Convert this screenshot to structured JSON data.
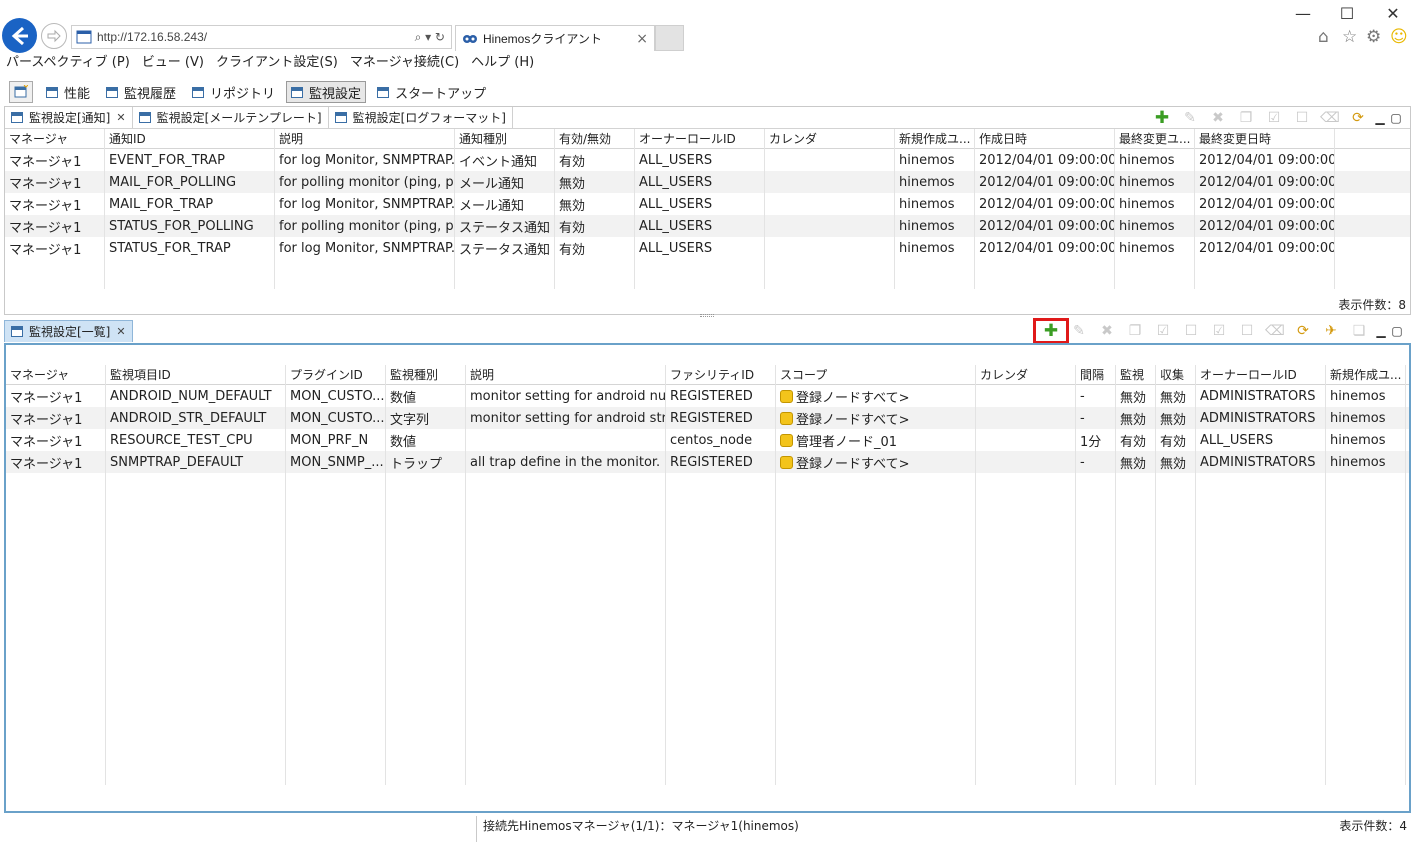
{
  "browser": {
    "url": "http://172.16.58.243/",
    "tab_title": "Hinemosクライアント",
    "url_controls": "⌕ ▾ ↻"
  },
  "menu": [
    "パースペクティブ (P)",
    "ビュー (V)",
    "クライアント設定(S)",
    "マネージャ接続(C)",
    "ヘルプ (H)"
  ],
  "perspectives": [
    "性能",
    "監視履歴",
    "リポジトリ",
    "監視設定",
    "スタートアップ"
  ],
  "upper": {
    "tabs": [
      "監視設定[通知]",
      "監視設定[メールテンプレート]",
      "監視設定[ログフォーマット]"
    ],
    "columns": [
      "マネージャ",
      "通知ID",
      "説明",
      "通知種別",
      "有効/無効",
      "オーナーロールID",
      "カレンダ",
      "新規作成ユ...",
      "作成日時",
      "最終変更ユ...",
      "最終変更日時"
    ],
    "rows": [
      [
        "マネージャ1",
        "EVENT_FOR_TRAP",
        "for log Monitor, SNMPTRAP...",
        "イベント通知",
        "有効",
        "ALL_USERS",
        "",
        "hinemos",
        "2012/04/01 09:00:00",
        "hinemos",
        "2012/04/01 09:00:00"
      ],
      [
        "マネージャ1",
        "MAIL_FOR_POLLING",
        "for polling monitor (ping, p...",
        "メール通知",
        "無効",
        "ALL_USERS",
        "",
        "hinemos",
        "2012/04/01 09:00:00",
        "hinemos",
        "2012/04/01 09:00:00"
      ],
      [
        "マネージャ1",
        "MAIL_FOR_TRAP",
        "for log Monitor, SNMPTRAP...",
        "メール通知",
        "無効",
        "ALL_USERS",
        "",
        "hinemos",
        "2012/04/01 09:00:00",
        "hinemos",
        "2012/04/01 09:00:00"
      ],
      [
        "マネージャ1",
        "STATUS_FOR_POLLING",
        "for polling monitor (ping, p...",
        "ステータス通知",
        "有効",
        "ALL_USERS",
        "",
        "hinemos",
        "2012/04/01 09:00:00",
        "hinemos",
        "2012/04/01 09:00:00"
      ],
      [
        "マネージャ1",
        "STATUS_FOR_TRAP",
        "for log Monitor, SNMPTRAP...",
        "ステータス通知",
        "有効",
        "ALL_USERS",
        "",
        "hinemos",
        "2012/04/01 09:00:00",
        "hinemos",
        "2012/04/01 09:00:00"
      ]
    ],
    "count": "表示件数：8"
  },
  "lower": {
    "tab": "監視設定[一覧]",
    "columns": [
      "マネージャ",
      "監視項目ID",
      "プラグインID",
      "監視種別",
      "説明",
      "ファシリティID",
      "スコープ",
      "カレンダ",
      "間隔",
      "監視",
      "収集",
      "オーナーロールID",
      "新規作成ユ..."
    ],
    "rows": [
      [
        "マネージャ1",
        "ANDROID_NUM_DEFAULT",
        "MON_CUSTO...",
        "数値",
        "monitor setting for android nu...",
        "REGISTERED",
        "登録ノードすべて>",
        "",
        "-",
        "無効",
        "無効",
        "ADMINISTRATORS",
        "hinemos"
      ],
      [
        "マネージャ1",
        "ANDROID_STR_DEFAULT",
        "MON_CUSTO...",
        "文字列",
        "monitor setting for android str...",
        "REGISTERED",
        "登録ノードすべて>",
        "",
        "-",
        "無効",
        "無効",
        "ADMINISTRATORS",
        "hinemos"
      ],
      [
        "マネージャ1",
        "RESOURCE_TEST_CPU",
        "MON_PRF_N",
        "数値",
        "",
        "centos_node",
        "管理者ノード_01",
        "",
        "1分",
        "有効",
        "有効",
        "ALL_USERS",
        "hinemos"
      ],
      [
        "マネージャ1",
        "SNMPTRAP_DEFAULT",
        "MON_SNMP_...",
        "トラップ",
        "all trap define in the monitor.",
        "REGISTERED",
        "登録ノードすべて>",
        "",
        "-",
        "無効",
        "無効",
        "ADMINISTRATORS",
        "hinemos"
      ]
    ],
    "count": "表示件数：4"
  },
  "status": "接続先Hinemosマネージャ(1/1)：マネージャ1(hinemos)",
  "colors": {
    "accent": "#1a63c4",
    "highlight": "#e01919",
    "add": "#3a9d23",
    "frame": "#6aa1c9"
  }
}
